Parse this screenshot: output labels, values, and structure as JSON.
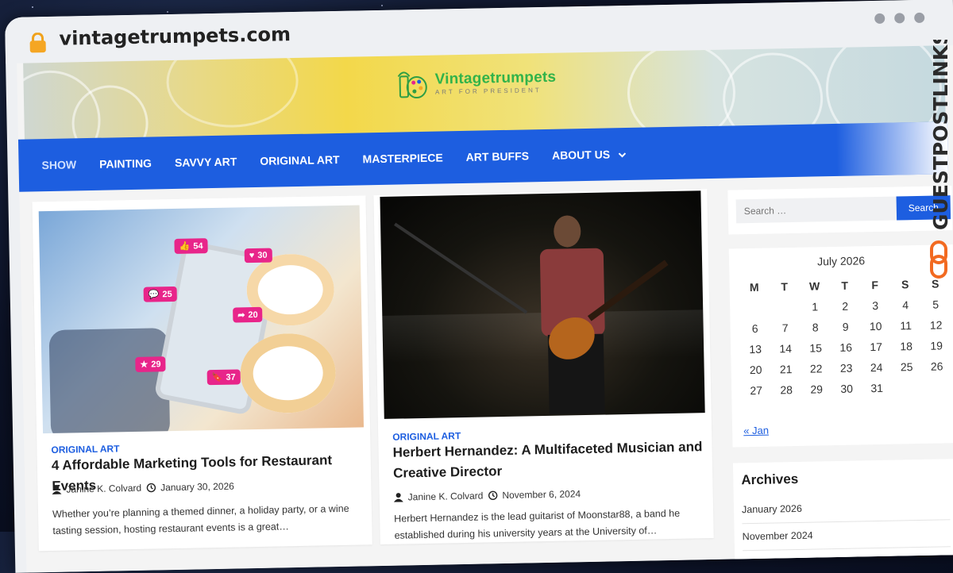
{
  "browser": {
    "url": "vintagetrumpets.com"
  },
  "site": {
    "title": "Vintagetrumpets",
    "tagline": "ART FOR PRESIDENT"
  },
  "nav": {
    "items": [
      "SHOW",
      "PAINTING",
      "SAVVY ART",
      "ORIGINAL ART",
      "MASTERPIECE",
      "ART BUFFS",
      "ABOUT US"
    ]
  },
  "posts": [
    {
      "category": "ORIGINAL ART",
      "title": "4 Affordable Marketing Tools for Restaurant Events",
      "author": "Janine K. Colvard",
      "date": "January 30, 2026",
      "excerpt": "Whether you’re planning a themed dinner, a holiday party, or a wine tasting session, hosting restaurant events is a great…",
      "badges": {
        "likes": "54",
        "hearts": "30",
        "comments": "25",
        "shares": "20",
        "stars": "29",
        "saves": "37"
      }
    },
    {
      "category": "ORIGINAL ART",
      "title": "Herbert Hernandez: A Multifaceted Musician and Creative Director",
      "author": "Janine K. Colvard",
      "date": "November 6, 2024",
      "excerpt": "Herbert Hernandez is the lead guitarist of Moonstar88, a band he established during his university years at the University of…"
    }
  ],
  "sidebar": {
    "search_placeholder": "Search …",
    "search_button": "Search",
    "calendar": {
      "caption": "July 2026",
      "weekdays": [
        "M",
        "T",
        "W",
        "T",
        "F",
        "S",
        "S"
      ],
      "days": [
        "",
        "",
        "1",
        "2",
        "3",
        "4",
        "5",
        "6",
        "7",
        "8",
        "9",
        "10",
        "11",
        "12",
        "13",
        "14",
        "15",
        "16",
        "17",
        "18",
        "19",
        "20",
        "21",
        "22",
        "23",
        "24",
        "25",
        "26",
        "27",
        "28",
        "29",
        "30",
        "31",
        "",
        ""
      ],
      "prev_link": "« Jan"
    },
    "archives": {
      "title": "Archives",
      "items": [
        "January 2026",
        "November 2024"
      ]
    }
  },
  "watermark": "GUESTPOSTLINKS",
  "colors": {
    "accent": "#1d5ee0",
    "logo_green": "#32b34a",
    "badge_pink": "#e8258a",
    "watermark_orange": "#f26a21"
  }
}
